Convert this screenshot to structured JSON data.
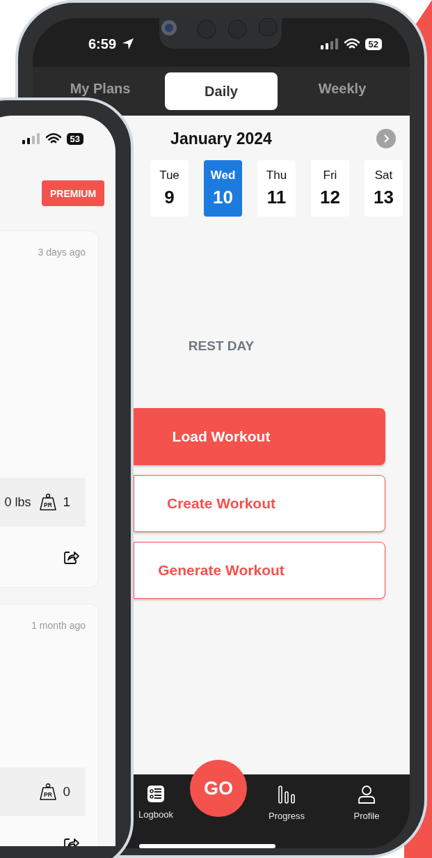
{
  "back_phone": {
    "status_bar": {
      "time": "6:59",
      "battery": "52"
    },
    "tabs": [
      {
        "label": "My Plans",
        "selected": false
      },
      {
        "label": "Daily",
        "selected": true
      },
      {
        "label": "Weekly",
        "selected": false
      }
    ],
    "calendar": {
      "month": "January 2024",
      "days": [
        {
          "weekday": "Tue",
          "date": "9",
          "selected": false
        },
        {
          "weekday": "Wed",
          "date": "10",
          "selected": true
        },
        {
          "weekday": "Thu",
          "date": "11",
          "selected": false
        },
        {
          "weekday": "Fri",
          "date": "12",
          "selected": false
        },
        {
          "weekday": "Sat",
          "date": "13",
          "selected": false
        }
      ]
    },
    "rest_label": "REST DAY",
    "actions": [
      {
        "label": "Load Workout",
        "kind": "primary"
      },
      {
        "label": "Create Workout",
        "kind": "outline"
      },
      {
        "label": "Generate Workout",
        "kind": "outline"
      }
    ],
    "nav": [
      {
        "label": "Logbook",
        "kind": "logbook"
      },
      {
        "label": "GO",
        "kind": "go"
      },
      {
        "label": "Progress",
        "kind": "progress"
      },
      {
        "label": "Profile",
        "kind": "profile"
      }
    ]
  },
  "front_phone": {
    "status_bar": {
      "battery": "53"
    },
    "badge": "PREMIUM",
    "cards": [
      {
        "time": "3 days ago",
        "stats": [
          {
            "kind": "text",
            "text": "0 lbs"
          },
          {
            "kind": "pr",
            "icon_text": "PR",
            "text": "1"
          }
        ]
      },
      {
        "time": "1 month ago",
        "stats": [
          {
            "kind": "pr",
            "icon_text": "PR",
            "text": "0"
          }
        ]
      }
    ]
  }
}
